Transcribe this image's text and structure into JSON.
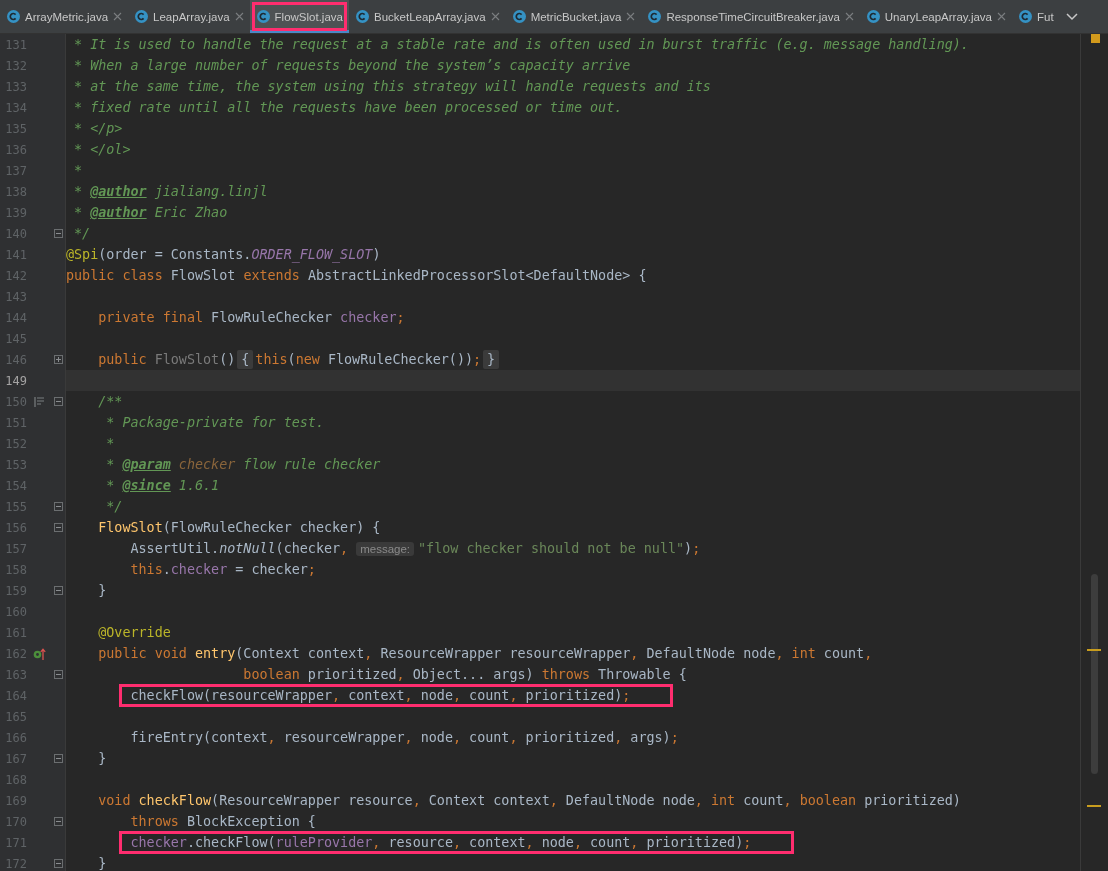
{
  "tabs": [
    {
      "label": "ArrayMetric.java",
      "selected": false,
      "boxed": false,
      "closable": true
    },
    {
      "label": "LeapArray.java",
      "selected": false,
      "boxed": false,
      "closable": true
    },
    {
      "label": "FlowSlot.java",
      "selected": true,
      "boxed": true,
      "closable": false
    },
    {
      "label": "BucketLeapArray.java",
      "selected": false,
      "boxed": false,
      "closable": true
    },
    {
      "label": "MetricBucket.java",
      "selected": false,
      "boxed": false,
      "closable": true
    },
    {
      "label": "ResponseTimeCircuitBreaker.java",
      "selected": false,
      "boxed": false,
      "closable": true
    },
    {
      "label": "UnaryLeapArray.java",
      "selected": false,
      "boxed": false,
      "closable": true
    },
    {
      "label": "Fut",
      "selected": false,
      "boxed": false,
      "closable": false
    }
  ],
  "lines": [
    {
      "number": "131",
      "tokens": [
        {
          "kind": "c",
          "text": " * It is used to handle the request at a stable rate and is often used in burst traffic (e.g. message handling)."
        }
      ]
    },
    {
      "number": "132",
      "tokens": [
        {
          "kind": "c",
          "text": " * When a large number of requests beyond the system’s capacity arrive"
        }
      ]
    },
    {
      "number": "133",
      "tokens": [
        {
          "kind": "c",
          "text": " * at the same time, the system using this strategy will handle requests and its"
        }
      ]
    },
    {
      "number": "134",
      "tokens": [
        {
          "kind": "c",
          "text": " * fixed rate until all the requests have been processed or time out."
        }
      ]
    },
    {
      "number": "135",
      "tokens": [
        {
          "kind": "c",
          "text": " * </p>"
        }
      ]
    },
    {
      "number": "136",
      "tokens": [
        {
          "kind": "c",
          "text": " * </ol>"
        }
      ]
    },
    {
      "number": "137",
      "tokens": [
        {
          "kind": "c",
          "text": " *"
        }
      ]
    },
    {
      "number": "138",
      "tokens": [
        {
          "kind": "c",
          "text": " * "
        },
        {
          "kind": "ct",
          "text": "@author"
        },
        {
          "kind": "c",
          "text": " jialiang.linjl"
        }
      ]
    },
    {
      "number": "139",
      "tokens": [
        {
          "kind": "c",
          "text": " * "
        },
        {
          "kind": "ct",
          "text": "@author"
        },
        {
          "kind": "c",
          "text": " Eric Zhao"
        }
      ]
    },
    {
      "number": "140",
      "foldable": true,
      "tokens": [
        {
          "kind": "c",
          "text": " */"
        }
      ]
    },
    {
      "number": "141",
      "tokens": [
        {
          "kind": "a",
          "text": "@Spi"
        },
        {
          "kind": "p",
          "text": "(order = Constants."
        },
        {
          "kind": "fs",
          "text": "ORDER_FLOW_SLOT"
        },
        {
          "kind": "p",
          "text": ")"
        }
      ]
    },
    {
      "number": "142",
      "tokens": [
        {
          "kind": "k",
          "text": "public class "
        },
        {
          "kind": "p",
          "text": "FlowSlot "
        },
        {
          "kind": "k",
          "text": "extends "
        },
        {
          "kind": "p",
          "text": "AbstractLinkedProcessorSlot<DefaultNode> {"
        }
      ]
    },
    {
      "number": "143"
    },
    {
      "number": "144",
      "tokens": [
        {
          "kind": "k",
          "text": "    private final "
        },
        {
          "kind": "p",
          "text": "FlowRuleChecker "
        },
        {
          "kind": "f",
          "text": "checker"
        },
        {
          "kind": "k",
          "text": ";"
        }
      ]
    },
    {
      "number": "145"
    },
    {
      "number": "146",
      "foldable": true,
      "collapsed": true,
      "tokens": [
        {
          "kind": "k",
          "text": "    public "
        },
        {
          "kind": "d",
          "text": "FlowSlot"
        },
        {
          "kind": "p",
          "text": "()"
        },
        {
          "kind": "fold",
          "text": "{"
        },
        {
          "kind": "k",
          "text": "this"
        },
        {
          "kind": "p",
          "text": "("
        },
        {
          "kind": "k",
          "text": "new "
        },
        {
          "kind": "p",
          "text": "FlowRuleChecker())"
        },
        {
          "kind": "k",
          "text": ";"
        },
        {
          "kind": "fold",
          "text": "}"
        }
      ]
    },
    {
      "number": "149",
      "current": true
    },
    {
      "number": "150",
      "foldable": true,
      "doc_icon": true,
      "tokens": [
        {
          "kind": "c",
          "text": "    /**"
        }
      ]
    },
    {
      "number": "151",
      "tokens": [
        {
          "kind": "c",
          "text": "     * Package-private for test."
        }
      ]
    },
    {
      "number": "152",
      "tokens": [
        {
          "kind": "c",
          "text": "     *"
        }
      ]
    },
    {
      "number": "153",
      "tokens": [
        {
          "kind": "c",
          "text": "     * "
        },
        {
          "kind": "ct",
          "text": "@param"
        },
        {
          "kind": "cp",
          "text": " checker"
        },
        {
          "kind": "c",
          "text": " flow rule checker"
        }
      ]
    },
    {
      "number": "154",
      "tokens": [
        {
          "kind": "c",
          "text": "     * "
        },
        {
          "kind": "ct",
          "text": "@since"
        },
        {
          "kind": "c",
          "text": " 1.6.1"
        }
      ]
    },
    {
      "number": "155",
      "foldable": true,
      "tokens": [
        {
          "kind": "c",
          "text": "     */"
        }
      ]
    },
    {
      "number": "156",
      "foldable": true,
      "tokens": [
        {
          "kind": "m",
          "text": "    FlowSlot"
        },
        {
          "kind": "p",
          "text": "(FlowRuleChecker checker) {"
        }
      ]
    },
    {
      "number": "157",
      "tokens": [
        {
          "kind": "p",
          "text": "        AssertUtil."
        },
        {
          "kind": "i",
          "text": "notNull"
        },
        {
          "kind": "p",
          "text": "(checker"
        },
        {
          "kind": "k",
          "text": ","
        },
        {
          "kind": "hint",
          "text": "message:"
        },
        {
          "kind": "s",
          "text": "\"flow checker should not be null\""
        },
        {
          "kind": "p",
          "text": ")"
        },
        {
          "kind": "k",
          "text": ";"
        }
      ]
    },
    {
      "number": "158",
      "tokens": [
        {
          "kind": "k",
          "text": "        this"
        },
        {
          "kind": "p",
          "text": "."
        },
        {
          "kind": "f",
          "text": "checker"
        },
        {
          "kind": "p",
          "text": " = checker"
        },
        {
          "kind": "k",
          "text": ";"
        }
      ]
    },
    {
      "number": "159",
      "foldable": true,
      "tokens": [
        {
          "kind": "p",
          "text": "    }"
        }
      ]
    },
    {
      "number": "160"
    },
    {
      "number": "161",
      "tokens": [
        {
          "kind": "a",
          "text": "    @Override"
        }
      ]
    },
    {
      "number": "162",
      "override_icon": true,
      "tokens": [
        {
          "kind": "k",
          "text": "    public void "
        },
        {
          "kind": "m",
          "text": "entry"
        },
        {
          "kind": "p",
          "text": "(Context context"
        },
        {
          "kind": "k",
          "text": ", "
        },
        {
          "kind": "p",
          "text": "ResourceWrapper resourceWrapper"
        },
        {
          "kind": "k",
          "text": ", "
        },
        {
          "kind": "p",
          "text": "DefaultNode node"
        },
        {
          "kind": "k",
          "text": ", int "
        },
        {
          "kind": "p",
          "text": "count"
        },
        {
          "kind": "k",
          "text": ","
        }
      ]
    },
    {
      "number": "163",
      "foldable": true,
      "tokens": [
        {
          "kind": "k",
          "text": "                      boolean "
        },
        {
          "kind": "p",
          "text": "prioritized"
        },
        {
          "kind": "k",
          "text": ", "
        },
        {
          "kind": "p",
          "text": "Object... args) "
        },
        {
          "kind": "k",
          "text": "throws "
        },
        {
          "kind": "p",
          "text": "Throwable {"
        }
      ]
    },
    {
      "number": "164",
      "boxed": true,
      "tokens": [
        {
          "kind": "p",
          "text": "        checkFlow(resourceWrapper"
        },
        {
          "kind": "k",
          "text": ", "
        },
        {
          "kind": "p",
          "text": "context"
        },
        {
          "kind": "k",
          "text": ", "
        },
        {
          "kind": "p",
          "text": "node"
        },
        {
          "kind": "k",
          "text": ", "
        },
        {
          "kind": "p",
          "text": "count"
        },
        {
          "kind": "k",
          "text": ", "
        },
        {
          "kind": "p",
          "text": "prioritized)"
        },
        {
          "kind": "k",
          "text": ";"
        }
      ]
    },
    {
      "number": "165"
    },
    {
      "number": "166",
      "tokens": [
        {
          "kind": "p",
          "text": "        fireEntry(context"
        },
        {
          "kind": "k",
          "text": ", "
        },
        {
          "kind": "p",
          "text": "resourceWrapper"
        },
        {
          "kind": "k",
          "text": ", "
        },
        {
          "kind": "p",
          "text": "node"
        },
        {
          "kind": "k",
          "text": ", "
        },
        {
          "kind": "p",
          "text": "count"
        },
        {
          "kind": "k",
          "text": ", "
        },
        {
          "kind": "p",
          "text": "prioritized"
        },
        {
          "kind": "k",
          "text": ", "
        },
        {
          "kind": "p",
          "text": "args)"
        },
        {
          "kind": "k",
          "text": ";"
        }
      ]
    },
    {
      "number": "167",
      "foldable": true,
      "tokens": [
        {
          "kind": "p",
          "text": "    }"
        }
      ]
    },
    {
      "number": "168"
    },
    {
      "number": "169",
      "tokens": [
        {
          "kind": "k",
          "text": "    void "
        },
        {
          "kind": "m",
          "text": "checkFlow"
        },
        {
          "kind": "p",
          "text": "(ResourceWrapper resource"
        },
        {
          "kind": "k",
          "text": ", "
        },
        {
          "kind": "p",
          "text": "Context context"
        },
        {
          "kind": "k",
          "text": ", "
        },
        {
          "kind": "p",
          "text": "DefaultNode node"
        },
        {
          "kind": "k",
          "text": ", int "
        },
        {
          "kind": "p",
          "text": "count"
        },
        {
          "kind": "k",
          "text": ", boolean "
        },
        {
          "kind": "p",
          "text": "prioritized)"
        }
      ]
    },
    {
      "number": "170",
      "foldable": true,
      "tokens": [
        {
          "kind": "k",
          "text": "        throws "
        },
        {
          "kind": "p",
          "text": "BlockException {"
        }
      ]
    },
    {
      "number": "171",
      "boxed": true,
      "tokens": [
        {
          "kind": "f",
          "text": "        checker"
        },
        {
          "kind": "p",
          "text": ".checkFlow("
        },
        {
          "kind": "f",
          "text": "ruleProvider"
        },
        {
          "kind": "k",
          "text": ", "
        },
        {
          "kind": "p",
          "text": "resource"
        },
        {
          "kind": "k",
          "text": ", "
        },
        {
          "kind": "p",
          "text": "context"
        },
        {
          "kind": "k",
          "text": ", "
        },
        {
          "kind": "p",
          "text": "node"
        },
        {
          "kind": "k",
          "text": ", "
        },
        {
          "kind": "p",
          "text": "count"
        },
        {
          "kind": "k",
          "text": ", "
        },
        {
          "kind": "p",
          "text": "prioritized)"
        },
        {
          "kind": "k",
          "text": ";"
        }
      ]
    },
    {
      "number": "172",
      "foldable": true,
      "tokens": [
        {
          "kind": "p",
          "text": "    }"
        }
      ]
    }
  ]
}
